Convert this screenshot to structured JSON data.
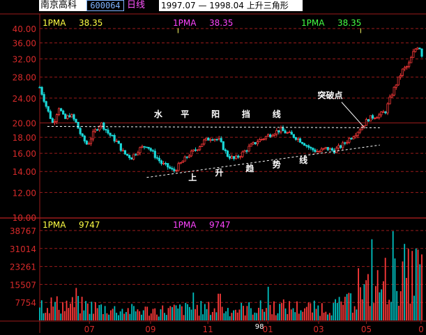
{
  "header": {
    "stock_name": "南京高科",
    "stock_code": "600064",
    "period": "日线",
    "pattern_title": "1997.07 — 1998.04 上升三角形"
  },
  "colors": {
    "background": "#000000",
    "grid": "#9b1b1b",
    "axis_text": "#d82a2a",
    "candle_up": "#ff3a3a",
    "candle_down": "#1ad7d7",
    "volume_down": "#00c0c0",
    "ma_label_yellow": "#ffff44",
    "ma_label_magenta": "#ff44ff",
    "ma_label_green": "#44ff44",
    "annotation": "#ffffff"
  },
  "chart_data": [
    {
      "type": "candlestick",
      "ylim": [
        10,
        40
      ],
      "yscale": "log",
      "yticks": [
        "40.00",
        "36.00",
        "32.00",
        "28.00",
        "24.00",
        "20.00",
        "18.00",
        "16.00",
        "14.00",
        "12.00",
        "10.00"
      ],
      "ytick_values": [
        40,
        36,
        32,
        28,
        24,
        20,
        18,
        16,
        14,
        12,
        10
      ],
      "xticks": [
        "07",
        "09",
        "11",
        "98",
        "01",
        "03",
        "05",
        "0"
      ],
      "ma_labels": [
        {
          "label": "1PMA",
          "value": "38.35",
          "color": "yellow"
        },
        {
          "label": "1PMA",
          "value": "38.35",
          "color": "magenta"
        },
        {
          "label": "1PMA",
          "value": "38.35",
          "color": "green"
        }
      ],
      "annotations": [
        {
          "text": "水",
          "x": 0.31,
          "y": 20.9
        },
        {
          "text": "平",
          "x": 0.38,
          "y": 20.9
        },
        {
          "text": "阳",
          "x": 0.46,
          "y": 20.9
        },
        {
          "text": "挡",
          "x": 0.54,
          "y": 20.9
        },
        {
          "text": "线",
          "x": 0.62,
          "y": 20.9
        },
        {
          "text": "上",
          "x": 0.4,
          "y": 13.1
        },
        {
          "text": "升",
          "x": 0.47,
          "y": 13.6
        },
        {
          "text": "趋",
          "x": 0.55,
          "y": 14.0
        },
        {
          "text": "势",
          "x": 0.62,
          "y": 14.4
        },
        {
          "text": "线",
          "x": 0.69,
          "y": 14.9
        },
        {
          "text": "突破点",
          "x": 0.76,
          "y": 24.0
        }
      ],
      "lines": [
        {
          "name": "resistance",
          "from": [
            0.02,
            19.5
          ],
          "to": [
            0.89,
            19.3
          ]
        },
        {
          "name": "support",
          "from": [
            0.28,
            13.4
          ],
          "to": [
            0.89,
            17.0
          ]
        },
        {
          "name": "breakout-pointer",
          "from": [
            0.79,
            23.3
          ],
          "to": [
            0.85,
            19.3
          ]
        }
      ],
      "markers": [
        {
          "x": 0.362,
          "value": 40.3
        },
        {
          "x": 0.84,
          "value": 40.3
        }
      ],
      "path": [
        {
          "x": 0.0,
          "y": 26.0
        },
        {
          "x": 0.02,
          "y": 22.0
        },
        {
          "x": 0.035,
          "y": 19.8
        },
        {
          "x": 0.05,
          "y": 22.5
        },
        {
          "x": 0.065,
          "y": 20.5
        },
        {
          "x": 0.08,
          "y": 21.3
        },
        {
          "x": 0.095,
          "y": 20.0
        },
        {
          "x": 0.11,
          "y": 18.0
        },
        {
          "x": 0.125,
          "y": 17.0
        },
        {
          "x": 0.14,
          "y": 18.5
        },
        {
          "x": 0.16,
          "y": 20.0
        },
        {
          "x": 0.18,
          "y": 18.5
        },
        {
          "x": 0.2,
          "y": 17.5
        },
        {
          "x": 0.22,
          "y": 16.0
        },
        {
          "x": 0.24,
          "y": 15.5
        },
        {
          "x": 0.26,
          "y": 16.5
        },
        {
          "x": 0.28,
          "y": 17.0
        },
        {
          "x": 0.3,
          "y": 15.8
        },
        {
          "x": 0.32,
          "y": 14.8
        },
        {
          "x": 0.335,
          "y": 14.5
        },
        {
          "x": 0.35,
          "y": 14.0
        },
        {
          "x": 0.37,
          "y": 14.9
        },
        {
          "x": 0.39,
          "y": 15.8
        },
        {
          "x": 0.41,
          "y": 16.5
        },
        {
          "x": 0.43,
          "y": 17.5
        },
        {
          "x": 0.45,
          "y": 18.0
        },
        {
          "x": 0.47,
          "y": 17.6
        },
        {
          "x": 0.49,
          "y": 15.8
        },
        {
          "x": 0.51,
          "y": 15.3
        },
        {
          "x": 0.53,
          "y": 16.0
        },
        {
          "x": 0.55,
          "y": 16.8
        },
        {
          "x": 0.57,
          "y": 17.5
        },
        {
          "x": 0.59,
          "y": 18.0
        },
        {
          "x": 0.61,
          "y": 18.6
        },
        {
          "x": 0.63,
          "y": 19.0
        },
        {
          "x": 0.65,
          "y": 18.5
        },
        {
          "x": 0.67,
          "y": 18.0
        },
        {
          "x": 0.69,
          "y": 17.3
        },
        {
          "x": 0.71,
          "y": 16.5
        },
        {
          "x": 0.73,
          "y": 16.2
        },
        {
          "x": 0.75,
          "y": 16.6
        },
        {
          "x": 0.77,
          "y": 16.3
        },
        {
          "x": 0.79,
          "y": 16.9
        },
        {
          "x": 0.81,
          "y": 17.8
        },
        {
          "x": 0.83,
          "y": 18.7
        },
        {
          "x": 0.845,
          "y": 19.6
        },
        {
          "x": 0.86,
          "y": 20.6
        },
        {
          "x": 0.875,
          "y": 21.0
        },
        {
          "x": 0.89,
          "y": 21.2
        },
        {
          "x": 0.905,
          "y": 21.8
        },
        {
          "x": 0.92,
          "y": 24.5
        },
        {
          "x": 0.935,
          "y": 27.0
        },
        {
          "x": 0.95,
          "y": 29.5
        },
        {
          "x": 0.965,
          "y": 30.5
        },
        {
          "x": 0.98,
          "y": 34.0
        },
        {
          "x": 0.992,
          "y": 35.5
        },
        {
          "x": 1.0,
          "y": 33.0
        }
      ]
    },
    {
      "type": "bar",
      "name": "volume",
      "ylim": [
        0,
        38767
      ],
      "yticks": [
        "38767",
        "31014",
        "23261",
        "15507",
        "7754"
      ],
      "ytick_values": [
        38767,
        31014,
        23261,
        15507,
        7754
      ],
      "ma_labels": [
        {
          "label": "1PMA",
          "value": "9747",
          "color": "yellow"
        },
        {
          "label": "1PMA",
          "value": "9747",
          "color": "magenta"
        }
      ],
      "seed": 7,
      "profile": [
        {
          "x": 0.0,
          "v": 7000
        },
        {
          "x": 0.1,
          "v": 6500
        },
        {
          "x": 0.2,
          "v": 4500
        },
        {
          "x": 0.3,
          "v": 4200
        },
        {
          "x": 0.42,
          "v": 5200
        },
        {
          "x": 0.5,
          "v": 4600
        },
        {
          "x": 0.62,
          "v": 5800
        },
        {
          "x": 0.72,
          "v": 5200
        },
        {
          "x": 0.8,
          "v": 6500
        },
        {
          "x": 0.86,
          "v": 13000
        },
        {
          "x": 0.93,
          "v": 17000
        },
        {
          "x": 1.0,
          "v": 21000
        }
      ],
      "spikes": [
        {
          "x": 0.095,
          "v": 14000
        },
        {
          "x": 0.4,
          "v": 12000
        },
        {
          "x": 0.47,
          "v": 11500
        },
        {
          "x": 0.6,
          "v": 14500
        },
        {
          "x": 0.8,
          "v": 10200
        },
        {
          "x": 0.835,
          "v": 22500
        },
        {
          "x": 0.87,
          "v": 35000
        },
        {
          "x": 0.905,
          "v": 27000
        },
        {
          "x": 0.925,
          "v": 38500
        },
        {
          "x": 0.955,
          "v": 33000
        },
        {
          "x": 0.985,
          "v": 31000
        }
      ]
    }
  ]
}
